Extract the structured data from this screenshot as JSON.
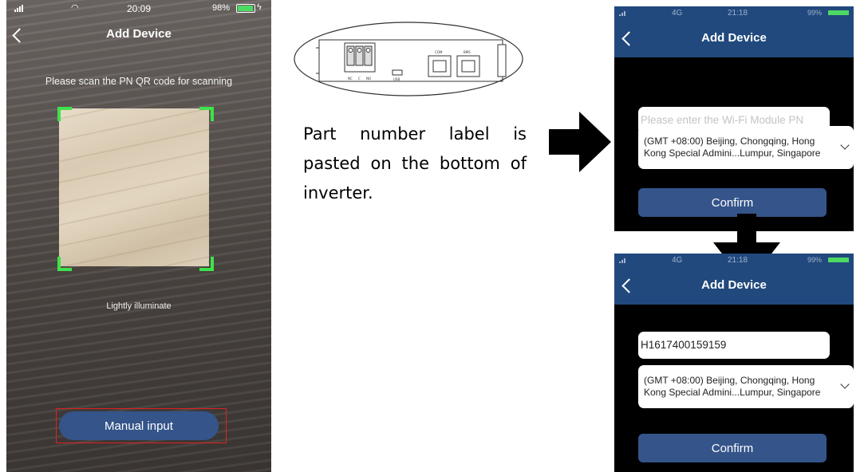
{
  "scan_screen": {
    "status": {
      "time": "20:09",
      "battery": "98%"
    },
    "title": "Add Device",
    "instruction": "Please scan the PN QR code for scanning",
    "illuminate": "Lightly illuminate",
    "manual_button": "Manual input"
  },
  "inverter_diagram": {
    "port_labels": [
      "NC",
      "C",
      "NO",
      "USB",
      "COM",
      "BMS"
    ]
  },
  "description": "Part number label is pasted on the bottom of inverter.",
  "phone_top": {
    "status": {
      "network": "4G",
      "time": "21:18",
      "battery": "99%"
    },
    "title": "Add Device",
    "pn_placeholder": "Please enter the Wi-Fi Module PN",
    "pn_value": "",
    "timezone_line1": "(GMT +08:00) Beijing, Chongqing, Hong",
    "timezone_line2": "Kong Special Admini...Lumpur, Singapore",
    "confirm": "Confirm"
  },
  "phone_bottom": {
    "status": {
      "network": "4G",
      "time": "21:18",
      "battery": "99%"
    },
    "title": "Add Device",
    "pn_value": "H1617400159159",
    "timezone_line1": "(GMT +08:00) Beijing, Chongqing, Hong",
    "timezone_line2": "Kong Special Admini...Lumpur, Singapore",
    "confirm": "Confirm"
  },
  "colors": {
    "header": "#21497d",
    "button": "#34548a",
    "scan_corner": "#3ee24a",
    "battery": "#4cd964",
    "highlight": "#e02020"
  }
}
